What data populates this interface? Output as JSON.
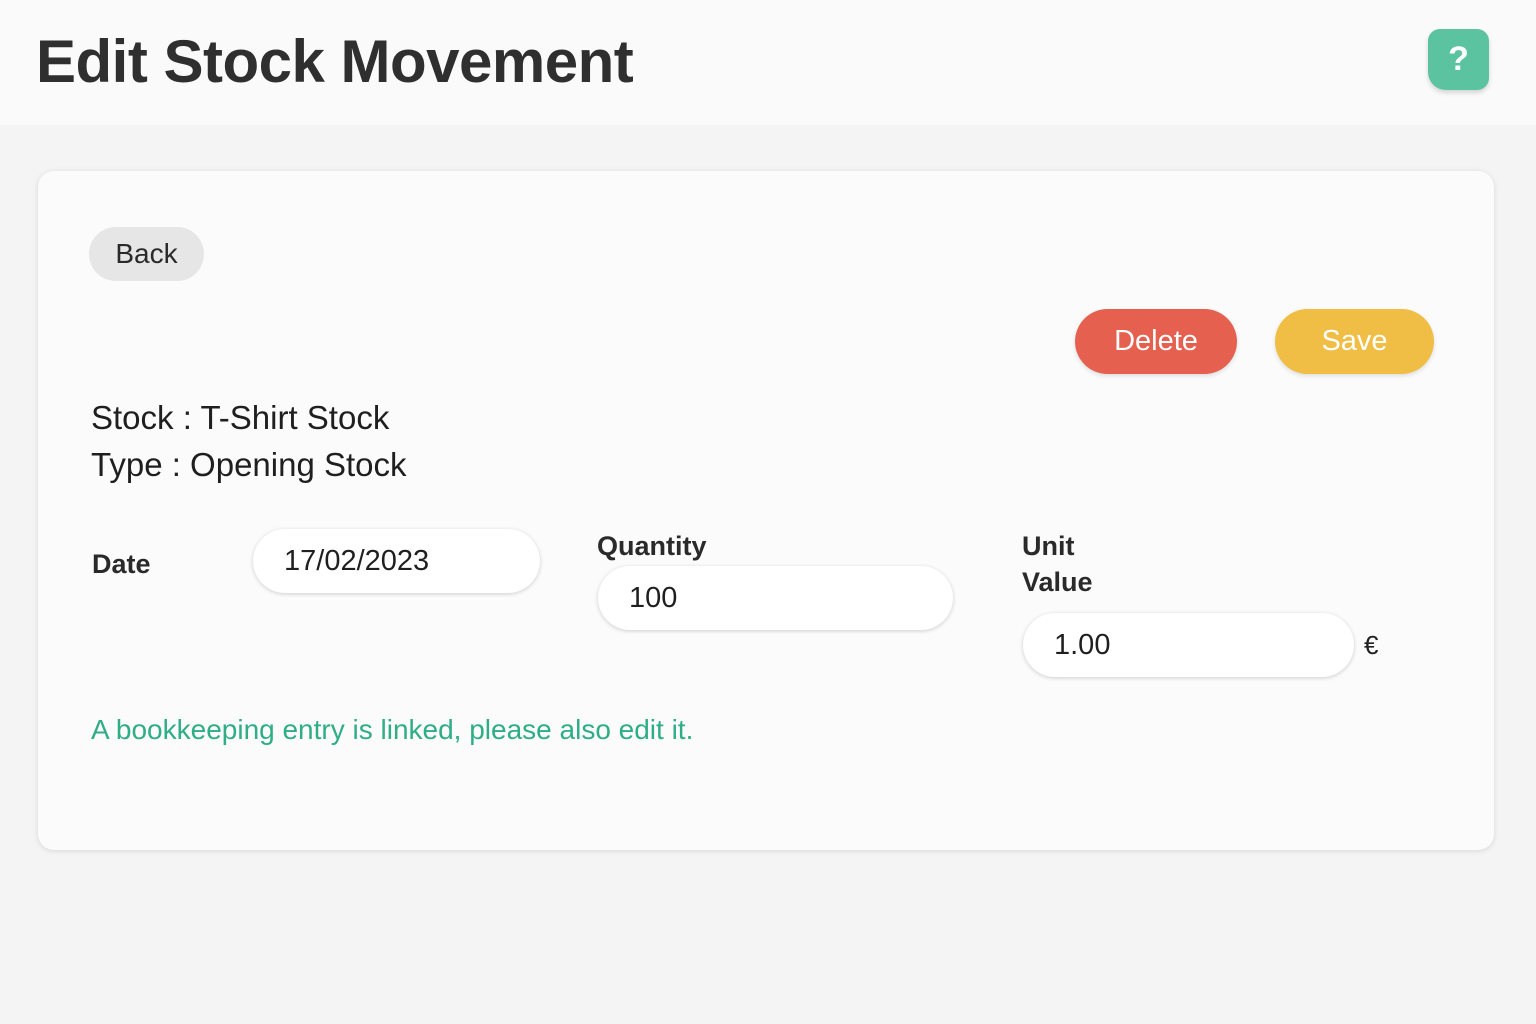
{
  "header": {
    "title": "Edit Stock Movement",
    "help_label": "?"
  },
  "card": {
    "back_label": "Back",
    "delete_label": "Delete",
    "save_label": "Save",
    "stock_line": "Stock : T-Shirt Stock",
    "type_line": "Type : Opening Stock",
    "fields": {
      "date": {
        "label": "Date",
        "value": "17/02/2023"
      },
      "quantity": {
        "label": "Quantity",
        "value": "100"
      },
      "unit_value": {
        "label_line1": "Unit",
        "label_line2": "Value",
        "value": "1.00",
        "currency": "€"
      }
    },
    "notice": "A bookkeeping entry is linked, please also edit it."
  },
  "colors": {
    "help": "#5cc3a0",
    "delete": "#e5604f",
    "save": "#f0bd45",
    "notice": "#2fae86"
  }
}
